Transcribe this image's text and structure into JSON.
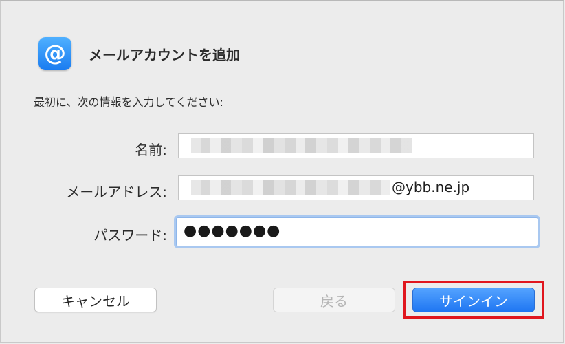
{
  "dialog": {
    "title": "メールアカウントを追加",
    "icon": "at-sign-icon",
    "icon_glyph": "@",
    "intro": "最初に、次の情報を入力してください:"
  },
  "form": {
    "name_label": "名前:",
    "name_value": "",
    "email_label": "メールアドレス:",
    "email_value_suffix": "@ybb.ne.jp",
    "password_label": "パスワード:",
    "password_value": "●●●●●●●"
  },
  "buttons": {
    "cancel": "キャンセル",
    "back": "戻る",
    "signin": "サインイン"
  },
  "colors": {
    "accent": "#1f76f2",
    "highlight": "#e0161e",
    "background": "#ececec"
  }
}
